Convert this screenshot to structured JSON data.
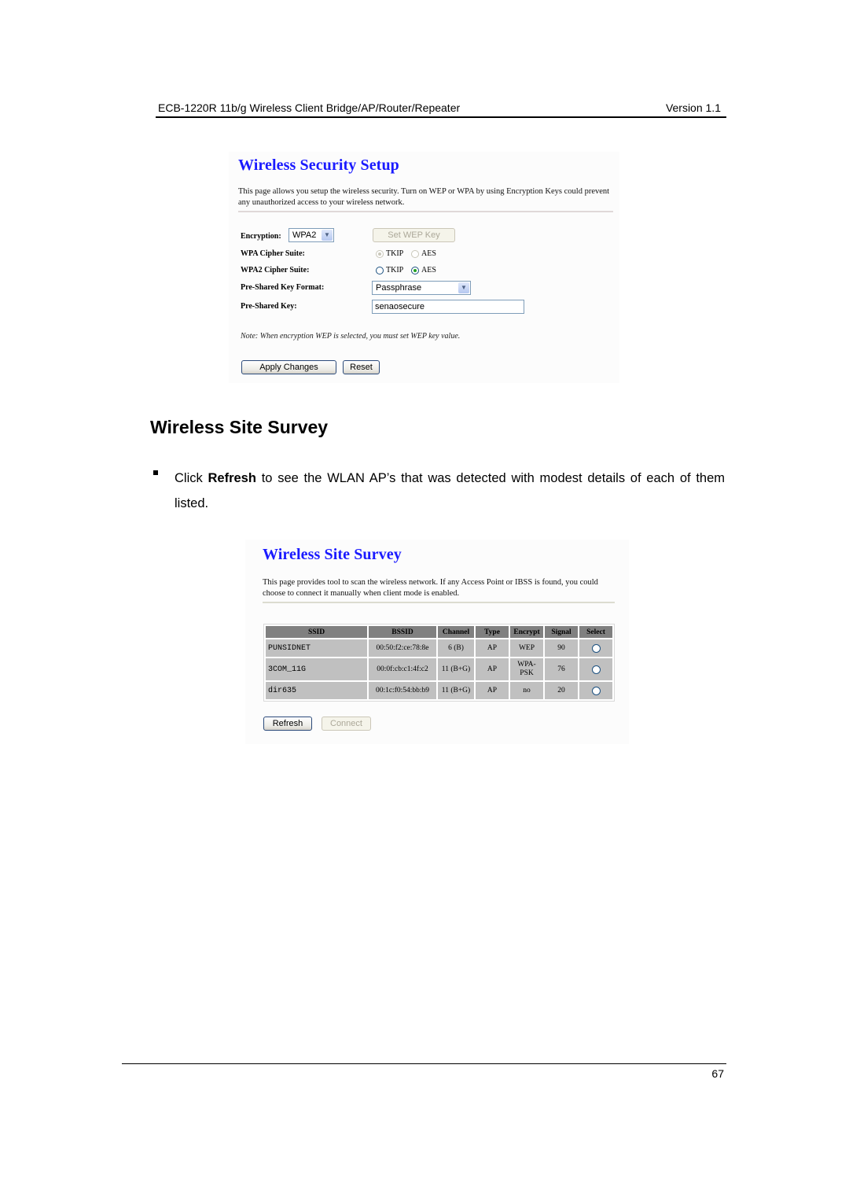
{
  "doc_header": {
    "title": "ECB-1220R 11b/g Wireless Client Bridge/AP/Router/Repeater",
    "version": "Version 1.1"
  },
  "security_setup": {
    "title": "Wireless Security Setup",
    "description": "This page allows you setup the wireless security. Turn on WEP or WPA by using Encryption Keys could prevent any unauthorized access to your wireless network.",
    "encryption_label": "Encryption:",
    "encryption_value": "WPA2",
    "set_wep_key_label": "Set WEP Key",
    "wpa_cipher_label": "WPA Cipher Suite:",
    "wpa2_cipher_label": "WPA2 Cipher Suite:",
    "cipher_tkip": "TKIP",
    "cipher_aes": "AES",
    "wpa_cipher_selected": "TKIP",
    "wpa2_cipher_selected": "AES",
    "psk_format_label": "Pre-Shared Key Format:",
    "psk_format_value": "Passphrase",
    "psk_label": "Pre-Shared Key:",
    "psk_value": "senaosecure",
    "note": "Note: When encryption WEP is selected, you must set WEP key value.",
    "apply_label": "Apply Changes",
    "reset_label": "Reset"
  },
  "section": {
    "heading": "Wireless Site Survey",
    "bullet_prefix": "Click ",
    "bullet_bold": "Refresh",
    "bullet_suffix": " to see the WLAN AP’s that was detected with modest details of each of them listed."
  },
  "site_survey": {
    "title": "Wireless Site Survey",
    "description": "This page provides tool to scan the wireless network. If any Access Point or IBSS is found, you could choose to connect it manually when client mode is enabled.",
    "columns": [
      "SSID",
      "BSSID",
      "Channel",
      "Type",
      "Encrypt",
      "Signal",
      "Select"
    ],
    "rows": [
      {
        "ssid": "PUNSIDNET",
        "bssid": "00:50:f2:ce:78:8e",
        "channel": "6 (B)",
        "type": "AP",
        "encrypt": "WEP",
        "signal": "90"
      },
      {
        "ssid": "3COM_11G",
        "bssid": "00:0f:cb:c1:4f:c2",
        "channel": "11 (B+G)",
        "type": "AP",
        "encrypt": "WPA-PSK",
        "signal": "76"
      },
      {
        "ssid": "dir635",
        "bssid": "00:1c:f0:54:bb:b9",
        "channel": "11 (B+G)",
        "type": "AP",
        "encrypt": "no",
        "signal": "20"
      }
    ],
    "refresh_label": "Refresh",
    "connect_label": "Connect"
  },
  "page_number": "67"
}
